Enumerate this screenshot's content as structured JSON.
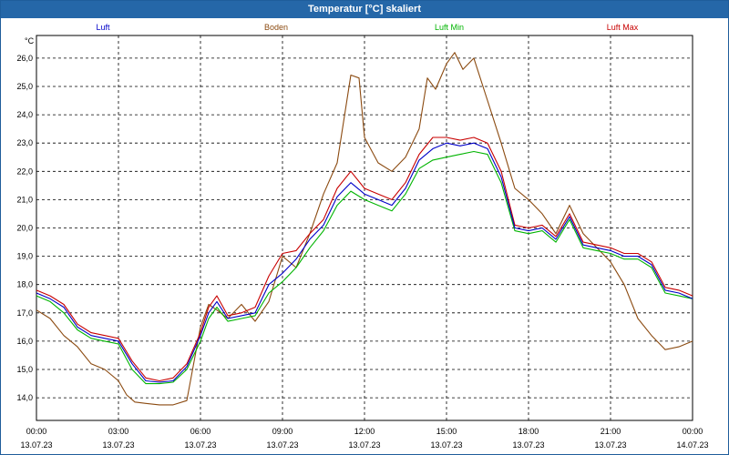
{
  "title": "Temperatur [°C] skaliert",
  "colors": {
    "titlebar": "#2567a8",
    "luft": "#0000c8",
    "boden": "#8b4a10",
    "luft_min": "#00b400",
    "luft_max": "#c80000",
    "grid": "#000000"
  },
  "chart_data": {
    "type": "line",
    "title": "Temperatur [°C] skaliert",
    "ylabel": "°C",
    "ylim": [
      13.2,
      26.8
    ],
    "xlim": [
      0,
      24
    ],
    "grid": true,
    "legend_position": "top",
    "y_ticks": [
      "14,0",
      "15,0",
      "16,0",
      "17,0",
      "18,0",
      "19,0",
      "20,0",
      "21,0",
      "22,0",
      "23,0",
      "24,0",
      "25,0",
      "26,0"
    ],
    "x_ticks": [
      {
        "time": "00:00",
        "date": "13.07.23"
      },
      {
        "time": "03:00",
        "date": "13.07.23"
      },
      {
        "time": "06:00",
        "date": "13.07.23"
      },
      {
        "time": "09:00",
        "date": "13.07.23"
      },
      {
        "time": "12:00",
        "date": "13.07.23"
      },
      {
        "time": "15:00",
        "date": "13.07.23"
      },
      {
        "time": "18:00",
        "date": "13.07.23"
      },
      {
        "time": "21:00",
        "date": "13.07.23"
      },
      {
        "time": "00:00",
        "date": "14.07.23"
      }
    ],
    "series": [
      {
        "name": "Luft",
        "color": "#0000c8",
        "x": [
          0,
          0.5,
          1,
          1.5,
          2,
          2.5,
          3,
          3.5,
          4,
          4.5,
          5,
          5.5,
          6,
          6.3,
          6.6,
          7,
          7.5,
          8,
          8.5,
          9,
          9.5,
          10,
          10.5,
          11,
          11.5,
          12,
          12.5,
          13,
          13.5,
          14,
          14.5,
          15,
          15.5,
          16,
          16.5,
          17,
          17.5,
          18,
          18.5,
          19,
          19.5,
          20,
          20.5,
          21,
          21.5,
          22,
          22.5,
          23,
          23.5,
          24
        ],
        "y": [
          17.7,
          17.5,
          17.2,
          16.5,
          16.2,
          16.1,
          16.0,
          15.2,
          14.6,
          14.55,
          14.6,
          15.1,
          16.2,
          17.0,
          17.4,
          16.8,
          16.9,
          17.0,
          18.0,
          18.4,
          18.9,
          19.6,
          20.1,
          21.1,
          21.6,
          21.2,
          21.0,
          20.8,
          21.4,
          22.4,
          22.8,
          23.0,
          22.9,
          23.0,
          22.8,
          21.8,
          20.0,
          19.9,
          20.0,
          19.6,
          20.4,
          19.4,
          19.3,
          19.2,
          19.0,
          19.0,
          18.7,
          17.8,
          17.7,
          17.5
        ]
      },
      {
        "name": "Boden",
        "color": "#8b4a10",
        "x": [
          0,
          0.5,
          1,
          1.5,
          2,
          2.5,
          3,
          3.3,
          3.6,
          4,
          4.5,
          5,
          5.5,
          6,
          6.3,
          6.6,
          7,
          7.5,
          8,
          8.5,
          9,
          9.5,
          10,
          10.5,
          11,
          11.5,
          11.8,
          12,
          12.5,
          13,
          13.5,
          14,
          14.3,
          14.6,
          15,
          15.3,
          15.6,
          16,
          16.5,
          17,
          17.5,
          18,
          18.5,
          19,
          19.5,
          20,
          20.5,
          21,
          21.5,
          22,
          22.5,
          23,
          23.5,
          24
        ],
        "y": [
          17.1,
          16.8,
          16.2,
          15.8,
          15.2,
          15.0,
          14.6,
          14.1,
          13.85,
          13.8,
          13.75,
          13.75,
          13.9,
          16.5,
          17.3,
          17.1,
          16.8,
          17.3,
          16.7,
          17.4,
          19.0,
          18.6,
          19.8,
          21.2,
          22.3,
          25.4,
          25.3,
          23.2,
          22.3,
          22.0,
          22.5,
          23.5,
          25.3,
          24.9,
          25.8,
          26.2,
          25.6,
          26.0,
          24.5,
          23.0,
          21.4,
          21.0,
          20.5,
          19.8,
          20.8,
          19.8,
          19.3,
          18.8,
          18.0,
          16.8,
          16.2,
          15.7,
          15.8,
          16.0
        ]
      },
      {
        "name": "Luft Min",
        "color": "#00b400",
        "x": [
          0,
          0.5,
          1,
          1.5,
          2,
          2.5,
          3,
          3.5,
          4,
          4.5,
          5,
          5.5,
          6,
          6.3,
          6.6,
          7,
          7.5,
          8,
          8.5,
          9,
          9.5,
          10,
          10.5,
          11,
          11.5,
          12,
          12.5,
          13,
          13.5,
          14,
          14.5,
          15,
          15.5,
          16,
          16.5,
          17,
          17.5,
          18,
          18.5,
          19,
          19.5,
          20,
          20.5,
          21,
          21.5,
          22,
          22.5,
          23,
          23.5,
          24
        ],
        "y": [
          17.6,
          17.4,
          17.0,
          16.4,
          16.1,
          16.0,
          15.9,
          15.0,
          14.5,
          14.5,
          14.55,
          15.0,
          16.0,
          16.8,
          17.2,
          16.7,
          16.8,
          16.9,
          17.7,
          18.1,
          18.6,
          19.3,
          19.9,
          20.8,
          21.3,
          21.0,
          20.8,
          20.6,
          21.2,
          22.1,
          22.4,
          22.5,
          22.6,
          22.7,
          22.6,
          21.6,
          19.9,
          19.8,
          19.9,
          19.5,
          20.3,
          19.3,
          19.2,
          19.1,
          18.9,
          18.9,
          18.6,
          17.7,
          17.6,
          17.5
        ]
      },
      {
        "name": "Luft Max",
        "color": "#c80000",
        "x": [
          0,
          0.5,
          1,
          1.5,
          2,
          2.5,
          3,
          3.5,
          4,
          4.5,
          5,
          5.5,
          6,
          6.3,
          6.6,
          7,
          7.5,
          8,
          8.5,
          9,
          9.5,
          10,
          10.5,
          11,
          11.5,
          12,
          12.5,
          13,
          13.5,
          14,
          14.5,
          15,
          15.5,
          16,
          16.5,
          17,
          17.5,
          18,
          18.5,
          19,
          19.5,
          20,
          20.5,
          21,
          21.5,
          22,
          22.5,
          23,
          23.5,
          24
        ],
        "y": [
          17.8,
          17.6,
          17.3,
          16.6,
          16.3,
          16.2,
          16.1,
          15.3,
          14.7,
          14.6,
          14.7,
          15.2,
          16.3,
          17.2,
          17.6,
          16.9,
          17.0,
          17.2,
          18.3,
          19.1,
          19.2,
          19.8,
          20.3,
          21.4,
          22.0,
          21.4,
          21.2,
          21.0,
          21.6,
          22.6,
          23.2,
          23.2,
          23.1,
          23.2,
          23.0,
          22.0,
          20.1,
          20.0,
          20.1,
          19.7,
          20.5,
          19.5,
          19.4,
          19.3,
          19.1,
          19.1,
          18.8,
          17.9,
          17.8,
          17.6
        ]
      }
    ]
  }
}
